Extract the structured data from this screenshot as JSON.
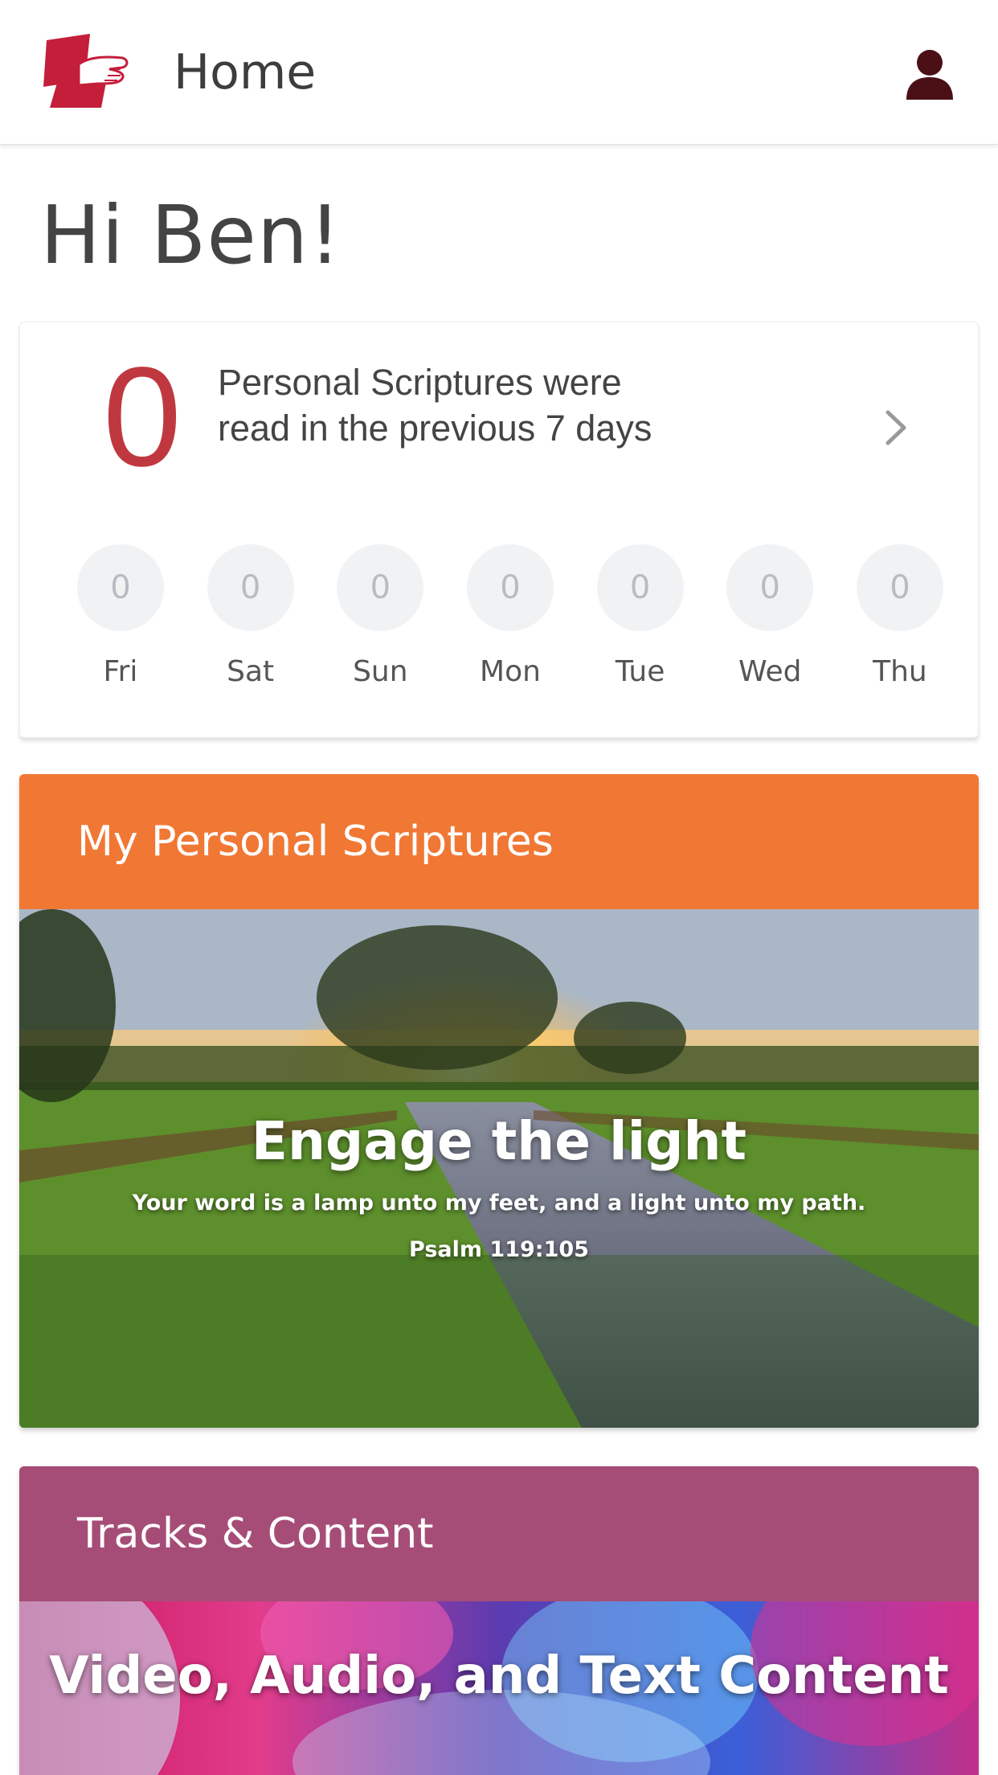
{
  "header": {
    "title": "Home",
    "logo_icon": "hand-book-logo",
    "profile_icon": "user-icon",
    "logo_color": "#c41e3a",
    "profile_color": "#4a1015"
  },
  "greeting": "Hi Ben!",
  "reading_stats": {
    "count": "0",
    "description": "Personal Scriptures were read in the previous 7 days",
    "count_color": "#c0383f",
    "days": [
      {
        "label": "Fri",
        "value": "0"
      },
      {
        "label": "Sat",
        "value": "0"
      },
      {
        "label": "Sun",
        "value": "0"
      },
      {
        "label": "Mon",
        "value": "0"
      },
      {
        "label": "Tue",
        "value": "0"
      },
      {
        "label": "Wed",
        "value": "0"
      },
      {
        "label": "Thu",
        "value": "0"
      }
    ]
  },
  "personal_scriptures": {
    "title": "My Personal Scriptures",
    "color": "#f07834",
    "image_title": "Engage the light",
    "image_verse": "Your word is a lamp unto my feet, and a light unto my path.",
    "image_reference": "Psalm 119:105"
  },
  "tracks": {
    "title": "Tracks & Content",
    "color": "#a64d77",
    "image_title": "Video, Audio, and Text Content"
  }
}
